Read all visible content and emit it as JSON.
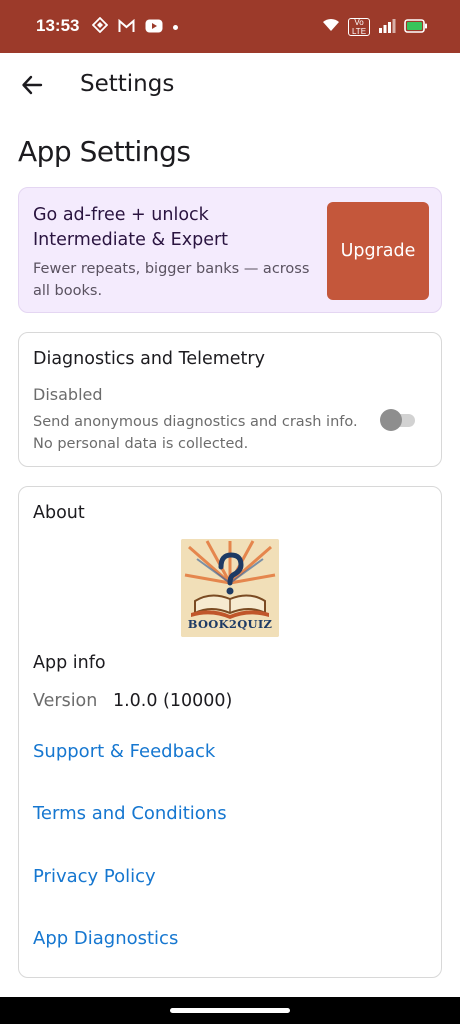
{
  "status_bar": {
    "time": "13:53",
    "left_icons": [
      "dropbox-like-icon",
      "gmail-icon",
      "youtube-icon",
      "dot-icon"
    ],
    "right_icons": [
      "wifi-icon",
      "volte-icon",
      "signal-icon",
      "battery-icon"
    ],
    "volte_line1": "Vo",
    "volte_line2": "LTE",
    "color": "#9c3a2a"
  },
  "app_bar": {
    "title": "Settings",
    "back_icon": "arrow-left-icon"
  },
  "page": {
    "title": "App Settings"
  },
  "upgrade": {
    "headline": "Go ad-free + unlock Intermediate & Expert",
    "subtext": "Fewer repeats, bigger banks — across all books.",
    "button_label": "Upgrade",
    "card_color": "#f4ebfd",
    "button_color": "#c4573b"
  },
  "telemetry": {
    "title": "Diagnostics and Telemetry",
    "status": "Disabled",
    "description": "Send anonymous diagnostics and crash info. No personal data is collected.",
    "enabled": false
  },
  "about": {
    "title": "About",
    "logo_text": "BOOK2QUIZ",
    "app_info_label": "App info",
    "version_label": "Version",
    "version_value": "1.0.0 (10000)",
    "links": [
      "Support & Feedback",
      "Terms and Conditions",
      "Privacy Policy",
      "App Diagnostics"
    ],
    "link_color": "#1677d0"
  }
}
